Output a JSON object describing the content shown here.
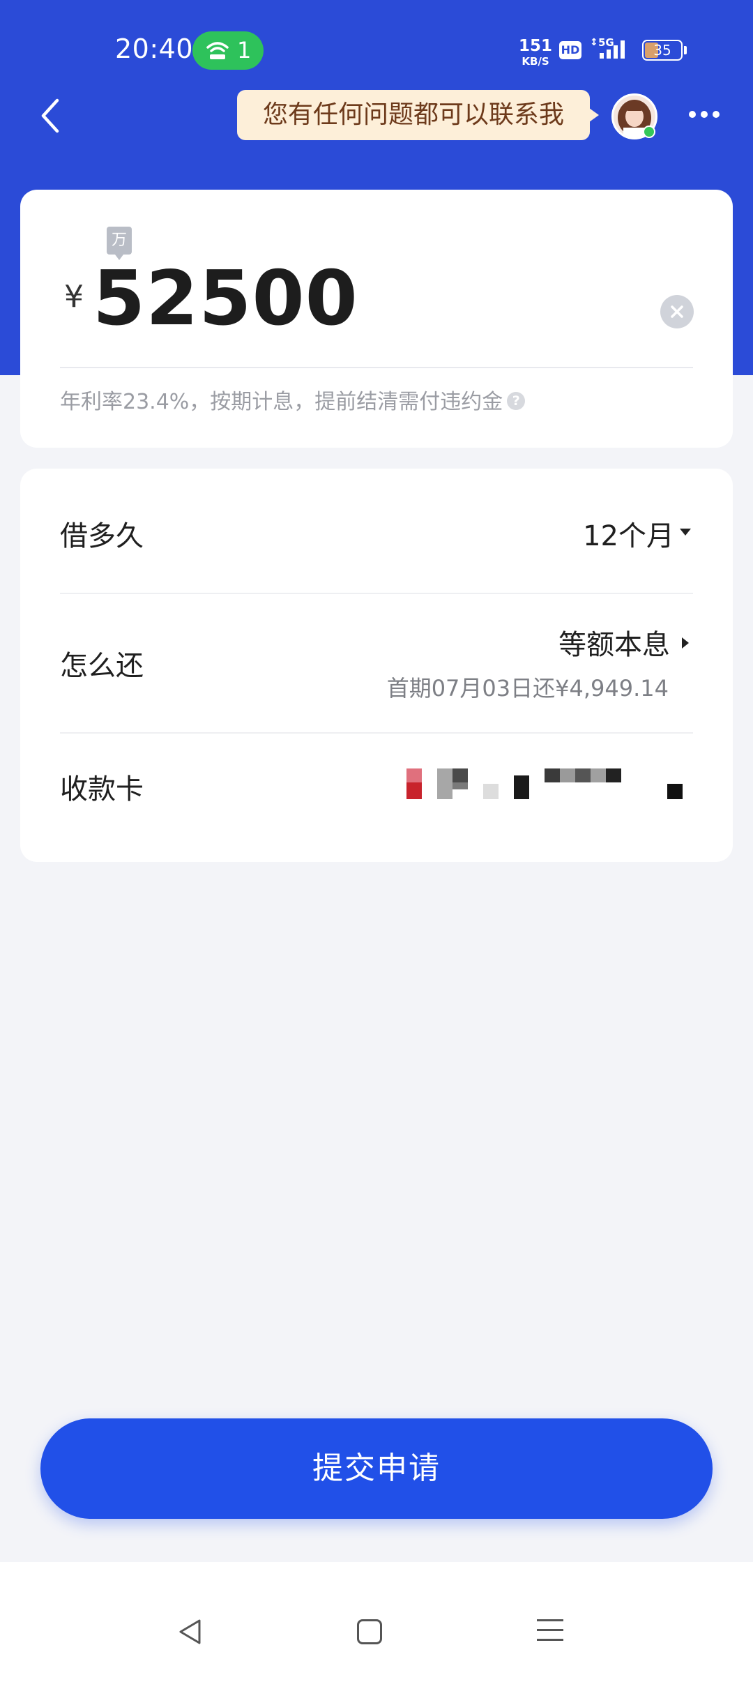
{
  "status_bar": {
    "time": "20:40",
    "hotspot_count": "1",
    "net_speed_value": "151",
    "net_speed_unit": "KB/S",
    "hd_label": "HD",
    "network_type": "5G",
    "battery": "35"
  },
  "nav": {
    "tooltip_text": "您有任何问题都可以联系我",
    "icons": [
      "back-arrow-icon",
      "avatar",
      "more-icon"
    ]
  },
  "amount_card": {
    "unit_tag": "万",
    "currency_symbol": "¥",
    "amount": "52500",
    "rate_note": "年利率23.4%，按期计息，提前结清需付违约金",
    "help_icon_glyph": "?"
  },
  "terms": {
    "duration_label": "借多久",
    "duration_value": "12个月",
    "repay_label": "怎么还",
    "repay_method": "等额本息",
    "repay_first": "首期07月03日还¥4,949.14",
    "card_label": "收款卡"
  },
  "submit": {
    "label": "提交申请"
  },
  "colors": {
    "header_blue": "#2b4bd7",
    "button_blue": "#2150e8",
    "hotspot_green": "#2ec25b",
    "tooltip_bg": "#fdefd9"
  }
}
